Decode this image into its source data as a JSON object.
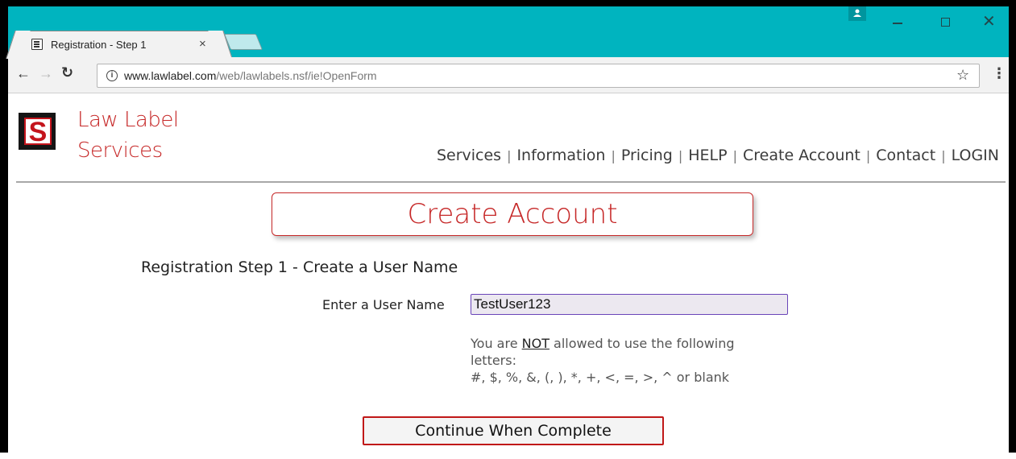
{
  "browser": {
    "tab_title": "Registration - Step 1",
    "tab_close": "×",
    "url_host": "www.lawlabel.com",
    "url_path": "/web/lawlabels.nsf/ie!OpenForm"
  },
  "site": {
    "brand_line1": "Law Label",
    "brand_line2": "Services",
    "logo_letter": "S",
    "nav": {
      "services": "Services",
      "information": "Information",
      "pricing": "Pricing",
      "help": "HELP",
      "create_account": "Create Account",
      "contact": "Contact",
      "login": "LOGIN"
    }
  },
  "form": {
    "title": "Create Account",
    "step_heading": "Registration Step 1 - Create a User Name",
    "username_label": "Enter a User Name",
    "username_value": "TestUser123",
    "hint_prefix": "You are ",
    "hint_emphasis": "NOT",
    "hint_suffix": " allowed to use the following letters:",
    "hint_chars": "#, $, %, &, (, ), *, +, <, =, >, ^ or blank",
    "continue_label": "Continue When Complete"
  },
  "colors": {
    "titlebar": "#00b4bf",
    "brand_red": "#c62828",
    "input_border": "#6a45b8"
  }
}
